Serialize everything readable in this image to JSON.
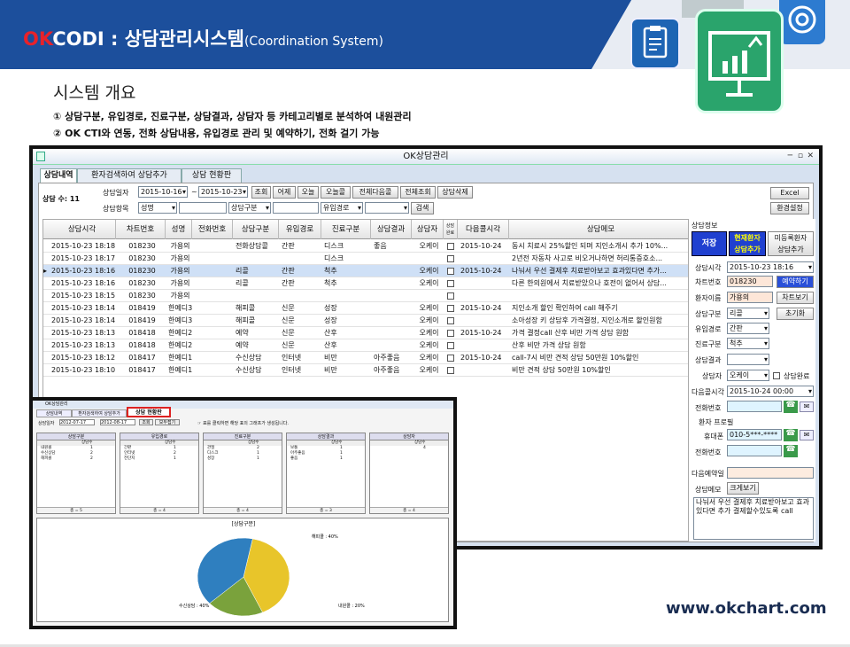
{
  "slide": {
    "brand_ok": "OK",
    "brand_rest": "CODI : 상담관리시스템",
    "brand_sub": "(Coordination System)",
    "overview_title": "시스템 개요",
    "bullets": [
      "①  상담구분, 유입경로, 진료구분, 상담결과, 상담자 등 카테고리별로 분석하여 내원관리",
      "②  OK CTI와 연동, 전화 상담내용, 유입경로 관리 및 예약하기, 전화 걸기 가능"
    ],
    "website": "www.okchart.com"
  },
  "window": {
    "title": "OK상담관리",
    "tabs": [
      "상담내역",
      "환자검색하여 상담추가",
      "상담 현황판"
    ],
    "count_label": "상담 수: 11",
    "date_label": "상담일자",
    "date_from": "2015-10-16",
    "tilde": "~",
    "date_to": "2015-10-23",
    "buttons": [
      "조회",
      "어제",
      "오늘",
      "오늘콜",
      "전체다음콜",
      "전체조회",
      "상담삭제"
    ],
    "item_label": "상담항목",
    "filter_name": "성명",
    "filter_type": "상담구분",
    "filter_route": "유입경로",
    "search_btn": "검색",
    "excel_btn": "Excel",
    "settings_btn": "환경설정"
  },
  "grid": {
    "headers": [
      "상담시각",
      "차트번호",
      "성명",
      "전화번호",
      "상담구분",
      "유입경로",
      "진료구분",
      "상담결과",
      "상담자",
      "상담\n완료",
      "다음콜시각",
      "상담메모"
    ],
    "rows": [
      {
        "time": "2015-10-23  18:18",
        "chart": "018230",
        "name": "가용의",
        "phone": "",
        "type": "전화상담콜",
        "route": "간판",
        "dept": "디스크",
        "result": "좋음",
        "staff": "오케이",
        "next": "2015-10-24",
        "memo": "동시 치료시 25%할인 되며 지인소개시 추가 10%..."
      },
      {
        "time": "2015-10-23  18:17",
        "chart": "018230",
        "name": "가용의",
        "phone": "",
        "type": "",
        "route": "",
        "dept": "디스크",
        "result": "",
        "staff": "",
        "next": "",
        "memo": "2년전 자동차 사고로 비오거나하면 허리통증호소..."
      },
      {
        "time": "2015-10-23  18:16",
        "chart": "018230",
        "name": "가용의",
        "phone": "",
        "type": "리콜",
        "route": "간판",
        "dept": "척추",
        "result": "",
        "staff": "오케이",
        "next": "2015-10-24",
        "memo": "나눠서 우선 결제후 치료받아보고 효과있다면 추가..."
      },
      {
        "time": "2015-10-23  18:16",
        "chart": "018230",
        "name": "가용의",
        "phone": "",
        "type": "리콜",
        "route": "간판",
        "dept": "척추",
        "result": "",
        "staff": "오케이",
        "next": "",
        "memo": "다른 한의원에서 치료받았으나 호전이 없어서 상담..."
      },
      {
        "time": "2015-10-23  18:15",
        "chart": "018230",
        "name": "가용의",
        "phone": "",
        "type": "",
        "route": "",
        "dept": "",
        "result": "",
        "staff": "",
        "next": "",
        "memo": ""
      },
      {
        "time": "2015-10-23  18:14",
        "chart": "018419",
        "name": "한예디3",
        "phone": "",
        "type": "해피콜",
        "route": "신문",
        "dept": "성장",
        "result": "",
        "staff": "오케이",
        "next": "2015-10-24",
        "memo": "지인소개 할인 확인하여 call 해주기"
      },
      {
        "time": "2015-10-23  18:14",
        "chart": "018419",
        "name": "한예디3",
        "phone": "",
        "type": "해피콜",
        "route": "신문",
        "dept": "성장",
        "result": "",
        "staff": "오케이",
        "next": "",
        "memo": "소아성장 키 상담후 가격결정, 지인소개로 할인원함"
      },
      {
        "time": "2015-10-23  18:13",
        "chart": "018418",
        "name": "한예디2",
        "phone": "",
        "type": "예약",
        "route": "신문",
        "dept": "산후",
        "result": "",
        "staff": "오케이",
        "next": "2015-10-24",
        "memo": "가격 결정call 산후 비만 가격 상담 원함"
      },
      {
        "time": "2015-10-23  18:13",
        "chart": "018418",
        "name": "한예디2",
        "phone": "",
        "type": "예약",
        "route": "신문",
        "dept": "산후",
        "result": "",
        "staff": "오케이",
        "next": "",
        "memo": "산후 비만 가격 상담 원함"
      },
      {
        "time": "2015-10-23  18:12",
        "chart": "018417",
        "name": "한예디1",
        "phone": "",
        "type": "수신상담",
        "route": "인터넷",
        "dept": "비만",
        "result": "아주좋음",
        "staff": "오케이",
        "next": "2015-10-24",
        "memo": "call-7시 비만 견적 상담 50만원 10%할인"
      },
      {
        "time": "2015-10-23  18:10",
        "chart": "018417",
        "name": "한예디1",
        "phone": "",
        "type": "수신상담",
        "route": "인터넷",
        "dept": "비만",
        "result": "아주좋음",
        "staff": "오케이",
        "next": "",
        "memo": "비만 견적 상담 50만원 10%할인"
      }
    ]
  },
  "right": {
    "section_title": "상담정보",
    "save_btn": "저장",
    "current_btn": "현재환자\n상담추가",
    "unreg_btn": "미등록환자\n상담추가",
    "time_label": "상담시각",
    "time_value": "2015-10-23  18:16",
    "chart_label": "차트번호",
    "chart_value": "018230",
    "reserve_btn": "예약하기",
    "patient_label": "환자이름",
    "patient_value": "가용의",
    "chartview_btn": "차트보기",
    "type_label": "상담구분",
    "type_value": "리콜",
    "reset_btn": "초기화",
    "route_label": "유입경로",
    "route_value": "간판",
    "dept_label": "진료구분",
    "dept_value": "척추",
    "result_label": "상담결과",
    "result_value": "",
    "staff_label": "상담자",
    "staff_value": "오케이",
    "done_label": "상담완료",
    "next_label": "다음콜시각",
    "next_value": "2015-10-24  00:00",
    "phone_label": "전화번호",
    "profile_title": "환자 프로필",
    "mobile_label": "휴대폰",
    "mobile_value": "010-5***-****",
    "tel_label": "전화번호",
    "nextres_label": "다음예약일",
    "memo_label": "상담메모",
    "enlarge_btn": "크게보기",
    "memo_text": "나눠서 우선 결제후 치료받아보고 효과있다면 추가 결제할수있도록 call"
  },
  "inset": {
    "title": "OK상담관리",
    "tabs": [
      "상담내역",
      "환자검색하여 상담추가",
      "상담 현황판"
    ],
    "date_label": "상담일자",
    "date_from": "2012-07-17",
    "date_to": "2012-08-17",
    "btn1": "조회",
    "btn2": "모두접기",
    "hint": "☞ 표를 클릭하면 해당 표의 그래프가 생성됩니다.",
    "boxes": [
      {
        "title": "상담구분",
        "col": "상담수",
        "rows": [
          [
            "내원콜",
            "1"
          ],
          [
            "수신상담",
            "2"
          ],
          [
            "해피콜",
            "2"
          ]
        ],
        "total": "총 = 5"
      },
      {
        "title": "유입경로",
        "col": "상담수",
        "rows": [
          [
            "간판",
            "1"
          ],
          [
            "인터넷",
            "2"
          ],
          [
            "전단지",
            "1"
          ]
        ],
        "total": "총 = 4"
      },
      {
        "title": "진료구분",
        "col": "상담수",
        "rows": [
          [
            "관절",
            "2"
          ],
          [
            "디스크",
            "1"
          ],
          [
            "성장",
            "1"
          ]
        ],
        "total": "총 = 4"
      },
      {
        "title": "상담결과",
        "col": "상담수",
        "rows": [
          [
            "보통",
            "1"
          ],
          [
            "아주좋음",
            "1"
          ],
          [
            "좋음",
            "1"
          ]
        ],
        "total": "총 = 3"
      },
      {
        "title": "상담자",
        "col": "상담수",
        "rows": [
          [
            "",
            "4"
          ]
        ],
        "total": "총 = 4"
      }
    ],
    "pie_title": "[상담구분]",
    "pie": [
      {
        "label": "해피콜 : 40%",
        "value": 40,
        "color": "#e8c52a"
      },
      {
        "label": "내원콜 : 20%",
        "value": 20,
        "color": "#7aa23c"
      },
      {
        "label": "수신상담 : 40%",
        "value": 40,
        "color": "#2f7fbf"
      }
    ]
  }
}
